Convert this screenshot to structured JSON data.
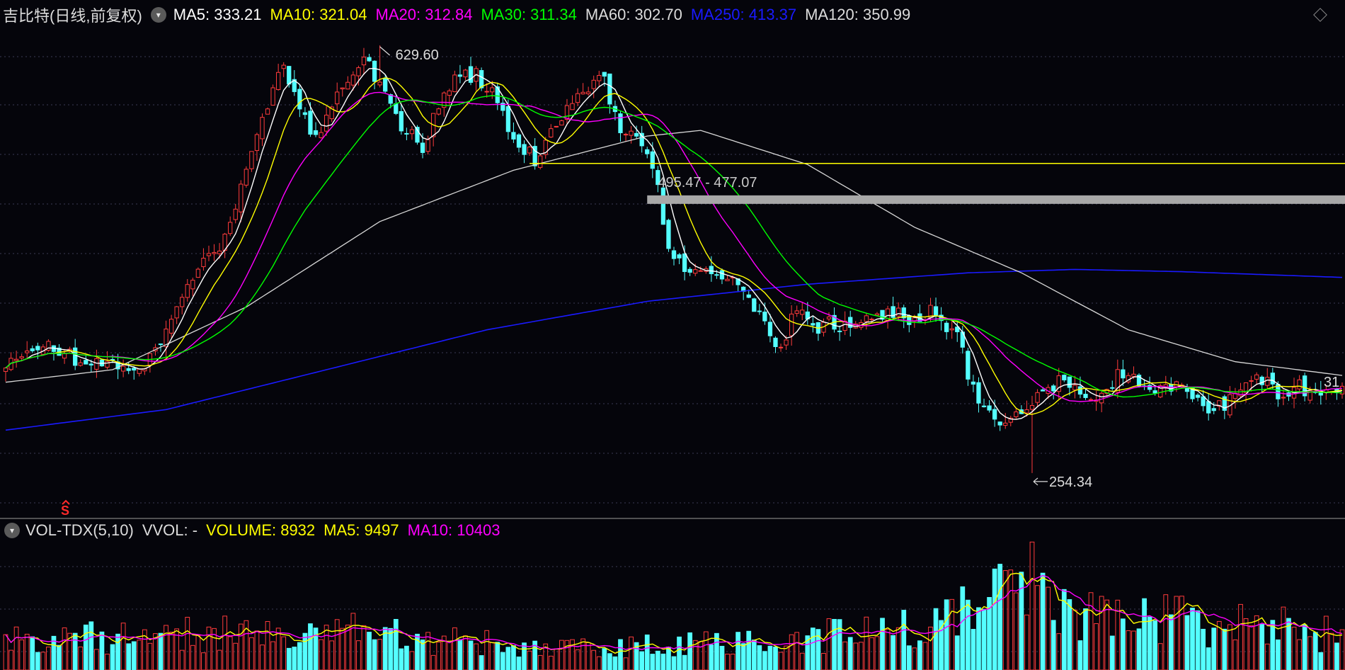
{
  "main_legend": {
    "title": "吉比特(日线,前复权)",
    "items": [
      {
        "key": "ma5",
        "text": "MA5: 333.21",
        "color": "#ffffff"
      },
      {
        "key": "ma10",
        "text": "MA10: 321.04",
        "color": "#ffff00"
      },
      {
        "key": "ma20",
        "text": "MA20: 312.84",
        "color": "#ff00ff"
      },
      {
        "key": "ma30",
        "text": "MA30: 311.34",
        "color": "#00ff00"
      },
      {
        "key": "ma60",
        "text": "MA60: 302.70",
        "color": "#dcdcdc"
      },
      {
        "key": "ma250",
        "text": "MA250: 413.37",
        "color": "#1a1aff"
      },
      {
        "key": "ma120",
        "text": "MA120: 350.99",
        "color": "#dcdcdc"
      }
    ]
  },
  "vol_legend": {
    "title": "VOL-TDX(5,10)",
    "vvol": "VVOL: -",
    "items": [
      {
        "key": "volume",
        "text": "VOLUME: 8932",
        "color": "#ffff00"
      },
      {
        "key": "vma5",
        "text": "MA5: 9497",
        "color": "#ffff00"
      },
      {
        "key": "vma10",
        "text": "MA10: 10403",
        "color": "#ff00ff"
      }
    ]
  },
  "annotations": {
    "high_label": "629.60",
    "low_label": "254.34",
    "range_label": "495.47 - 477.07",
    "signal_label": "S",
    "right_cut_label": "31"
  },
  "colors": {
    "background": "#05050b",
    "up": "#ff3b3b",
    "down": "#54ffff",
    "grid": "#3c3c54",
    "support_line": "#ffff00",
    "range_band": "#a8a8a8"
  },
  "chart_data": {
    "type": "candlestick",
    "title": "吉比特(日线,前复权)",
    "price_ylim": [
      217,
      647
    ],
    "anchors": [
      [
        0,
        346
      ],
      [
        6,
        366
      ],
      [
        8,
        368
      ],
      [
        12,
        357
      ],
      [
        15,
        348
      ],
      [
        17,
        349
      ],
      [
        20,
        356
      ],
      [
        23,
        342
      ],
      [
        26,
        345
      ],
      [
        30,
        380
      ],
      [
        34,
        425
      ],
      [
        38,
        440
      ],
      [
        42,
        470
      ],
      [
        45,
        520
      ],
      [
        50,
        593
      ],
      [
        52,
        607
      ],
      [
        55,
        570
      ],
      [
        58,
        550
      ],
      [
        62,
        590
      ],
      [
        65,
        600
      ],
      [
        67,
        622
      ],
      [
        70,
        596
      ],
      [
        74,
        560
      ],
      [
        78,
        540
      ],
      [
        82,
        590
      ],
      [
        86,
        604
      ],
      [
        88,
        603
      ],
      [
        92,
        580
      ],
      [
        95,
        545
      ],
      [
        99,
        530
      ],
      [
        102,
        555
      ],
      [
        106,
        580
      ],
      [
        110,
        600
      ],
      [
        112,
        600
      ],
      [
        115,
        550
      ],
      [
        118,
        548
      ],
      [
        121,
        527
      ],
      [
        124,
        455
      ],
      [
        127,
        430
      ],
      [
        130,
        431
      ],
      [
        133,
        433
      ],
      [
        136,
        420
      ],
      [
        140,
        397
      ],
      [
        143,
        378
      ],
      [
        145,
        365
      ],
      [
        148,
        398
      ],
      [
        151,
        380
      ],
      [
        154,
        386
      ],
      [
        158,
        380
      ],
      [
        162,
        392
      ],
      [
        166,
        396
      ],
      [
        170,
        390
      ],
      [
        173,
        395
      ],
      [
        176,
        385
      ],
      [
        178,
        374
      ],
      [
        182,
        310
      ],
      [
        185,
        300
      ],
      [
        189,
        302
      ],
      [
        193,
        320
      ],
      [
        197,
        335
      ],
      [
        201,
        328
      ],
      [
        204,
        316
      ],
      [
        208,
        340
      ],
      [
        212,
        335
      ],
      [
        215,
        325
      ],
      [
        219,
        330
      ],
      [
        223,
        322
      ],
      [
        226,
        310
      ],
      [
        230,
        320
      ],
      [
        234,
        338
      ],
      [
        238,
        326
      ],
      [
        242,
        330
      ],
      [
        246,
        325
      ],
      [
        250,
        330
      ]
    ],
    "ma_series": [
      {
        "name": "MA5",
        "color": "#ffffff",
        "period": 5
      },
      {
        "name": "MA10",
        "color": "#ffff00",
        "period": 10
      },
      {
        "name": "MA20",
        "color": "#ff00ff",
        "period": 20
      },
      {
        "name": "MA30",
        "color": "#00ff00",
        "period": 30
      },
      {
        "name": "MA120",
        "color": "#d8d8d8",
        "period": 120
      }
    ],
    "ma250_curve": [
      [
        0,
        292
      ],
      [
        30,
        310
      ],
      [
        60,
        345
      ],
      [
        90,
        380
      ],
      [
        120,
        405
      ],
      [
        150,
        420
      ],
      [
        180,
        430
      ],
      [
        200,
        433
      ],
      [
        220,
        431
      ],
      [
        250,
        426
      ]
    ],
    "ma60_curve": [
      [
        0,
        334
      ],
      [
        20,
        345
      ],
      [
        45,
        400
      ],
      [
        70,
        475
      ],
      [
        95,
        520
      ],
      [
        120,
        550
      ],
      [
        130,
        555
      ],
      [
        150,
        525
      ],
      [
        170,
        470
      ],
      [
        190,
        430
      ],
      [
        210,
        380
      ],
      [
        230,
        352
      ],
      [
        250,
        340
      ]
    ],
    "high": {
      "index": 70,
      "value": 629.6
    },
    "low": {
      "index": 192,
      "value": 254.34
    },
    "support_price": 526,
    "range_band_price": 495.47,
    "range_label_price": 477.07,
    "volume": {
      "ylim": [
        0,
        35000
      ],
      "last": 8932,
      "ma5": 9497,
      "ma10": 10403,
      "anchors": [
        [
          0,
          8000
        ],
        [
          40,
          10000
        ],
        [
          60,
          11000
        ],
        [
          85,
          7500
        ],
        [
          110,
          6000
        ],
        [
          125,
          6500
        ],
        [
          150,
          9000
        ],
        [
          175,
          12500
        ],
        [
          188,
          20000
        ],
        [
          195,
          17000
        ],
        [
          215,
          14000
        ],
        [
          235,
          12000
        ],
        [
          250,
          9000
        ]
      ],
      "spikes": [
        [
          192,
          34000
        ],
        [
          190,
          26000
        ],
        [
          195,
          22000
        ],
        [
          189,
          20500
        ]
      ]
    }
  }
}
